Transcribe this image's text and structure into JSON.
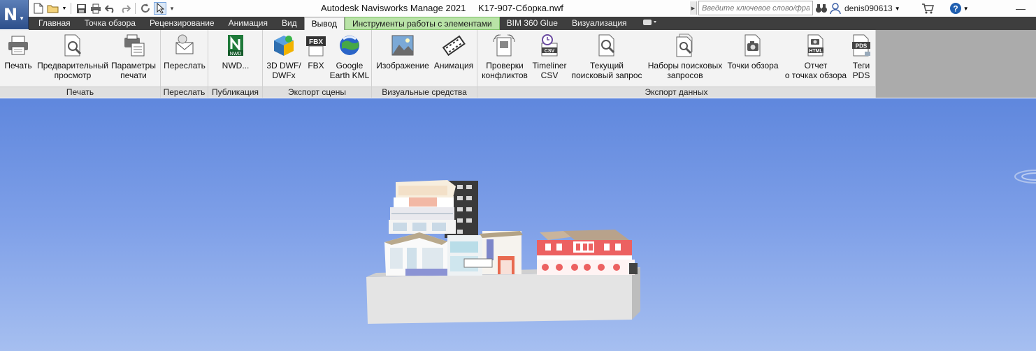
{
  "app": {
    "logo_letter": "N",
    "title": "Autodesk Navisworks Manage 2021",
    "file_name": "K17-907-Сборка.nwf"
  },
  "search": {
    "placeholder": "Введите ключевое слово/фразу"
  },
  "user": {
    "name": "denis090613"
  },
  "tabs": [
    {
      "label": "Главная"
    },
    {
      "label": "Точка обзора"
    },
    {
      "label": "Рецензирование"
    },
    {
      "label": "Анимация"
    },
    {
      "label": "Вид"
    },
    {
      "label": "Вывод"
    },
    {
      "label": "Инструменты работы с элементами"
    },
    {
      "label": "BIM 360 Glue"
    },
    {
      "label": "Визуализация"
    }
  ],
  "ribbon": {
    "panels": [
      {
        "label": "Печать",
        "buttons": [
          "Печать",
          "Предварительный\nпросмотр",
          "Параметры\nпечати"
        ]
      },
      {
        "label": "Переслать",
        "buttons": [
          "Переслать"
        ]
      },
      {
        "label": "Публикация",
        "buttons": [
          "NWD..."
        ]
      },
      {
        "label": "Экспорт сцены",
        "buttons": [
          "3D DWF/\nDWFx",
          "FBX",
          "Google\nEarth KML"
        ]
      },
      {
        "label": "Визуальные средства",
        "buttons": [
          "Изображение",
          "Анимация"
        ]
      },
      {
        "label": "Экспорт данных",
        "buttons": [
          "Проверки\nконфликтов",
          "Timeliner\nCSV",
          "Текущий\nпоисковый запрос",
          "Наборы поисковых\nзапросов",
          "Точки обзора",
          "Отчет\nо точках обзора",
          "Теги\nPDS"
        ]
      }
    ]
  },
  "icon_text": {
    "nwd": "NWD",
    "fbx": "FBX",
    "csv": "CSV",
    "html": "HTML",
    "pds": "PDS"
  },
  "colors": {
    "tabbar": "#3e3e3e",
    "contextual_tab": "#b9e3a7",
    "viewport_top": "#5f87dd",
    "viewport_bottom": "#a6bff0"
  }
}
